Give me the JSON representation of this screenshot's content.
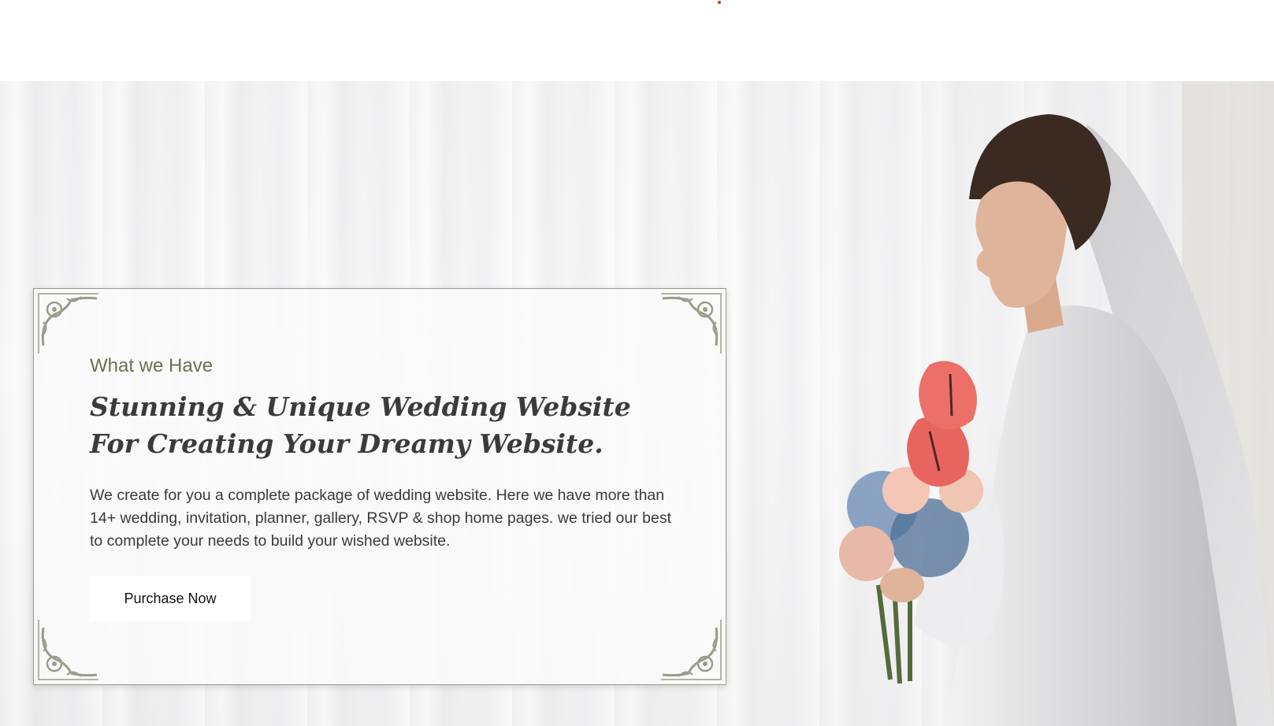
{
  "hero": {
    "eyebrow": "What we Have",
    "title": "Stunning & Unique Wedding Website For Creating Your Dreamy Website.",
    "description": "We create for you a complete package of wedding website. Here we have more than 14+ wedding, invitation, planner, gallery, RSVP & shop home pages. we tried our best to complete your needs to build your wished website.",
    "button_label": "Purchase Now"
  },
  "icons": {
    "corner_ornament": "flourish-corner-icon"
  },
  "colors": {
    "accent_olive": "#6d6f4e",
    "frame": "#9a9c8c",
    "bouquet_red": "#e8655f"
  }
}
